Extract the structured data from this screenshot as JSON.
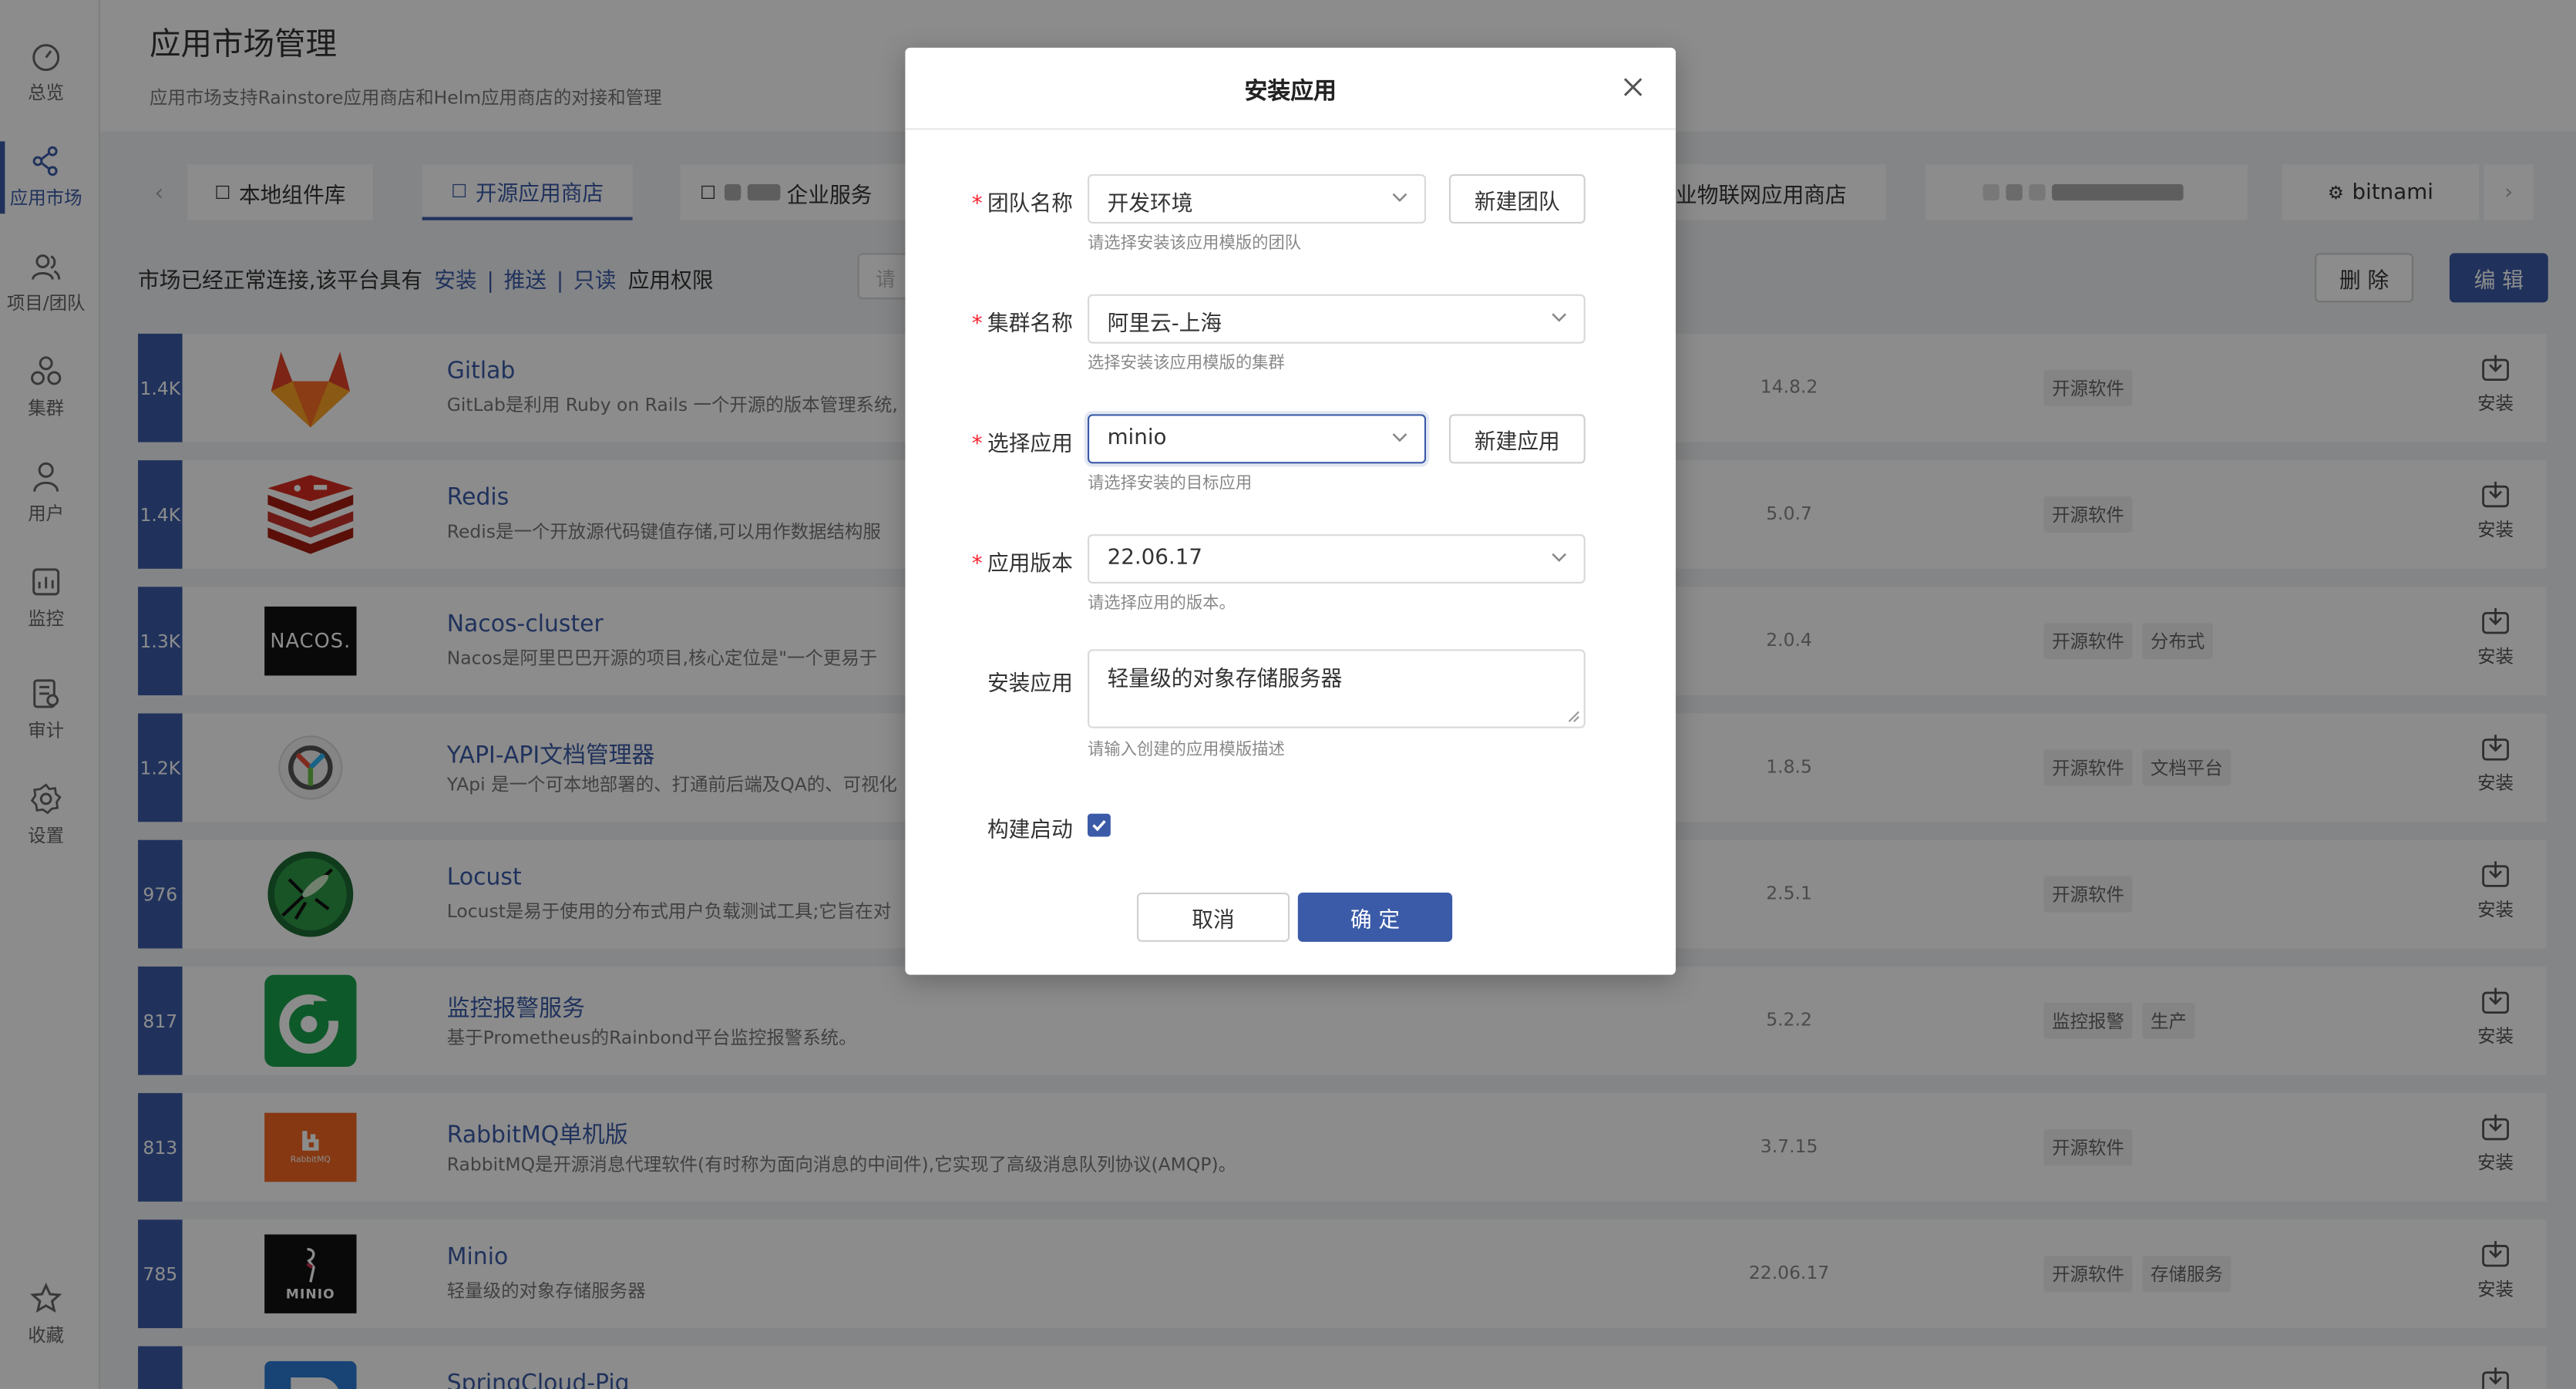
{
  "sidebar": {
    "items": [
      {
        "label": "总览",
        "icon": "dashboard-icon"
      },
      {
        "label": "应用市场",
        "icon": "share-icon",
        "active": true
      },
      {
        "label": "项目/团队",
        "icon": "team-icon"
      },
      {
        "label": "集群",
        "icon": "cluster-icon"
      },
      {
        "label": "用户",
        "icon": "user-icon"
      },
      {
        "label": "监控",
        "icon": "monitor-icon"
      },
      {
        "label": "审计",
        "icon": "audit-icon"
      },
      {
        "label": "设置",
        "icon": "gear-icon"
      }
    ],
    "bottom": {
      "label": "收藏",
      "icon": "star-icon"
    }
  },
  "header": {
    "title": "应用市场管理",
    "subtitle": "应用市场支持Rainstore应用商店和Helm应用商店的对接和管理"
  },
  "tabs": {
    "prev": "‹",
    "next": "›",
    "items": [
      {
        "label": "本地组件库",
        "icon": "☐"
      },
      {
        "label": "开源应用商店",
        "icon": "☐",
        "active": true
      },
      {
        "label": "企业服务",
        "icon": "☐"
      },
      {
        "label": "业物联网应用商店",
        "icon": ""
      },
      {
        "label": "",
        "icon": ""
      },
      {
        "label": "bitnami",
        "icon": "⚙"
      }
    ]
  },
  "status": {
    "prefix": "市场已经正常连接,该平台具有",
    "perm_install": "安装",
    "sep1": "|",
    "perm_push": "推送",
    "sep2": "|",
    "perm_read": "只读",
    "suffix": "应用权限"
  },
  "search": {
    "placeholder": "请"
  },
  "toolbar": {
    "delete_label": "删 除",
    "edit_label": "编 辑"
  },
  "apps": [
    {
      "count": "1.4K",
      "name": "Gitlab",
      "desc": "GitLab是利用 Ruby on Rails 一个开源的版本管理系统,",
      "version": "14.8.2",
      "tags": [
        "开源软件"
      ],
      "install": "安装",
      "logo": "gitlab"
    },
    {
      "count": "1.4K",
      "name": "Redis",
      "desc": "Redis是一个开放源代码键值存储,可以用作数据结构服",
      "version": "5.0.7",
      "tags": [
        "开源软件"
      ],
      "install": "安装",
      "logo": "redis"
    },
    {
      "count": "1.3K",
      "name": "Nacos-cluster",
      "desc": "Nacos是阿里巴巴开源的项目,核心定位是\"一个更易于",
      "version": "2.0.4",
      "tags": [
        "开源软件",
        "分布式"
      ],
      "install": "安装",
      "logo": "nacos",
      "logo_text": "NACOS."
    },
    {
      "count": "1.2K",
      "name": "YAPI-API文档管理器",
      "desc": "YApi 是一个可本地部署的、打通前后端及QA的、可视化",
      "version": "1.8.5",
      "tags": [
        "开源软件",
        "文档平台"
      ],
      "install": "安装",
      "logo": "yapi"
    },
    {
      "count": "976",
      "name": "Locust",
      "desc": "Locust是易于使用的分布式用户负载测试工具;它旨在对",
      "version": "2.5.1",
      "tags": [
        "开源软件"
      ],
      "install": "安装",
      "logo": "locust"
    },
    {
      "count": "817",
      "name": "监控报警服务",
      "desc": "基于Prometheus的Rainbond平台监控报警系统。",
      "version": "5.2.2",
      "tags": [
        "监控报警",
        "生产"
      ],
      "install": "安装",
      "logo": "monitor"
    },
    {
      "count": "813",
      "name": "RabbitMQ单机版",
      "desc": "RabbitMQ是开源消息代理软件(有时称为面向消息的中间件),它实现了高级消息队列协议(AMQP)。",
      "version": "3.7.15",
      "tags": [
        "开源软件"
      ],
      "install": "安装",
      "logo": "rabbitmq",
      "logo_text": "RabbitMQ"
    },
    {
      "count": "785",
      "name": "Minio",
      "desc": "轻量级的对象存储服务器",
      "version": "22.06.17",
      "tags": [
        "开源软件",
        "存储服务"
      ],
      "install": "安装",
      "logo": "minio",
      "logo_text": "MINIO"
    },
    {
      "count": "",
      "name": "SpringCloud-Pig",
      "desc": "",
      "version": "",
      "tags": [],
      "install": "",
      "logo": "pig"
    }
  ],
  "modal": {
    "title": "安装应用",
    "team": {
      "label": "团队名称",
      "value": "开发环境",
      "help": "请选择安装该应用模版的团队",
      "side_button": "新建团队"
    },
    "cluster": {
      "label": "集群名称",
      "value": "阿里云-上海",
      "help": "选择安装该应用模版的集群"
    },
    "app": {
      "label": "选择应用",
      "value": "minio",
      "help": "请选择安装的目标应用",
      "side_button": "新建应用"
    },
    "version": {
      "label": "应用版本",
      "value": "22.06.17",
      "help": "请选择应用的版本。"
    },
    "desc": {
      "label": "安装应用",
      "value": "轻量级的对象存储服务器",
      "help": "请输入创建的应用模版描述"
    },
    "build": {
      "label": "构建启动",
      "checked": true
    },
    "cancel_label": "取消",
    "ok_label": "确 定"
  },
  "colors": {
    "primary": "#3b5ba8",
    "required": "#f5222d",
    "overlay": "rgba(0,0,0,0.45)"
  }
}
